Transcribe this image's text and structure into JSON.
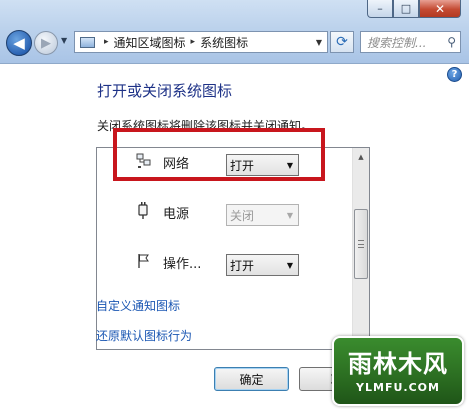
{
  "window": {
    "address": {
      "segment1": "通知区域图标",
      "segment2": "系统图标",
      "separator": "▸"
    },
    "search_placeholder": "搜索控制...",
    "buttons": {
      "minimize": "–",
      "maximize": "□",
      "close": "✕"
    }
  },
  "help_icon": "?",
  "page": {
    "title": "打开或关闭系统图标",
    "description": "关闭系统图标将删除该图标并关闭通知。"
  },
  "icons_list": {
    "items": [
      {
        "icon": "network-icon",
        "label": "网络",
        "value": "打开",
        "enabled": true
      },
      {
        "icon": "power-icon",
        "label": "电源",
        "value": "关闭",
        "enabled": false
      },
      {
        "icon": "flag-icon",
        "label": "操作...",
        "value": "打开",
        "enabled": true
      }
    ],
    "scrollbar_position": 0.45
  },
  "highlight_color": "#c8161d",
  "links": {
    "customize": "自定义通知图标",
    "restore": "还原默认图标行为"
  },
  "dialog_buttons": {
    "ok": "确定",
    "cancel": "取"
  },
  "watermark": {
    "text": "雨林木风",
    "url": "YLMFU.COM",
    "color": "#2b6d21"
  }
}
